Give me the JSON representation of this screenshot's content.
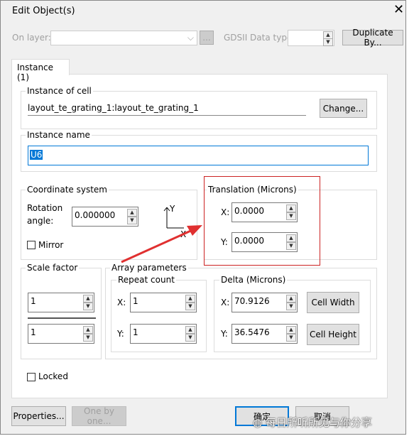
{
  "window": {
    "title": "Edit Object(s)",
    "close": "✕"
  },
  "top": {
    "on_layer_label": "On layer:",
    "more": "...",
    "gdsii_label": "GDSII Data type:",
    "duplicate_by": "Duplicate By..."
  },
  "tab": {
    "label": "Instance (1)"
  },
  "instance_of_cell": {
    "label": "Instance of cell",
    "value": "layout_te_grating_1:layout_te_grating_1",
    "change": "Change..."
  },
  "instance_name": {
    "label": "Instance name",
    "value": "U6"
  },
  "coordinate_system": {
    "label": "Coordinate system",
    "rotation_label_1": "Rotation",
    "rotation_label_2": "angle:",
    "rotation": "0.000000",
    "mirror": "Mirror",
    "axis_y": "Y",
    "axis_x": "X"
  },
  "translation": {
    "label": "Translation (Microns)",
    "x_label": "X:",
    "x": "0.0000",
    "y_label": "Y:",
    "y": "0.0000"
  },
  "scale_factor": {
    "label": "Scale factor",
    "value1": "1",
    "value2": "1"
  },
  "array": {
    "label": "Array parameters",
    "repeat_label": "Repeat count",
    "x_label": "X:",
    "x": "1",
    "y_label": "Y:",
    "y": "1",
    "delta_label": "Delta (Microns)",
    "dx": "70.9126",
    "dy": "36.5476",
    "cell_width": "Cell Width",
    "cell_height": "Cell Height"
  },
  "locked": "Locked",
  "buttons": {
    "properties": "Properties...",
    "one_by_one": "One by one...",
    "ok": "确定",
    "cancel": "取消"
  },
  "watermark": "每日所听所见与你分享",
  "colors": {
    "highlight": "#cc2222",
    "selection": "#0078d7"
  }
}
